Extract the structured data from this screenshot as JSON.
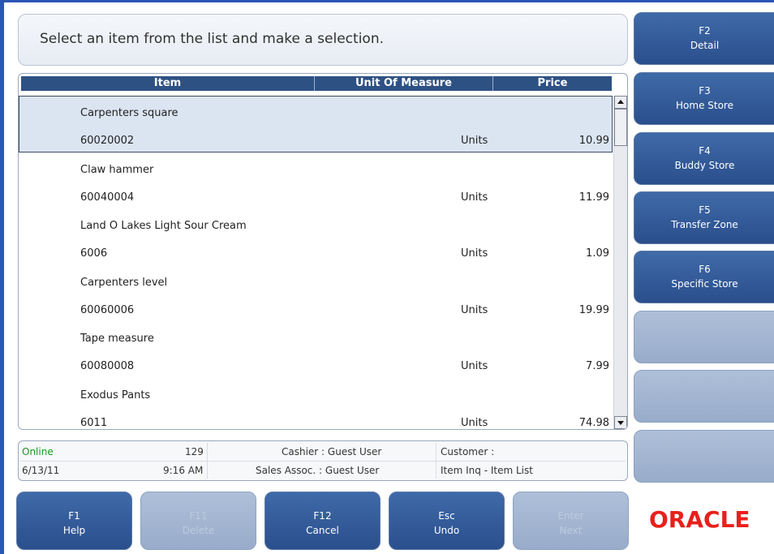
{
  "prompt": "Select an item from the list and make a selection.",
  "list": {
    "headers": {
      "item": "Item",
      "uom": "Unit Of Measure",
      "price": "Price"
    },
    "rows": [
      {
        "name": "Carpenters square",
        "code": "60020002",
        "uom": "Units",
        "price": "10.99",
        "selected": true
      },
      {
        "name": "Claw hammer",
        "code": "60040004",
        "uom": "Units",
        "price": "11.99"
      },
      {
        "name": "Land O Lakes Light Sour Cream",
        "code": "6006",
        "uom": "Units",
        "price": "1.09"
      },
      {
        "name": "Carpenters level",
        "code": "60060006",
        "uom": "Units",
        "price": "19.99"
      },
      {
        "name": "Tape measure",
        "code": "60080008",
        "uom": "Units",
        "price": "7.99"
      },
      {
        "name": "Exodus Pants",
        "code": "6011",
        "uom": "Units",
        "price": "74.98"
      }
    ]
  },
  "status": {
    "online": "Online",
    "register": "129",
    "cashier": "Cashier : Guest User",
    "customer": "Customer :",
    "date": "6/13/11",
    "time": "9:16 AM",
    "sales_assoc": "Sales Assoc. : Guest User",
    "screen": "Item Inq - Item List",
    "online_color": "#1a9a1a"
  },
  "right_buttons": [
    {
      "key": "F2",
      "label": "Detail"
    },
    {
      "key": "F3",
      "label": "Home Store"
    },
    {
      "key": "F4",
      "label": "Buddy Store"
    },
    {
      "key": "F5",
      "label": "Transfer Zone"
    },
    {
      "key": "F6",
      "label": "Specific Store"
    },
    {
      "key": "",
      "label": ""
    },
    {
      "key": "",
      "label": ""
    },
    {
      "key": "",
      "label": ""
    }
  ],
  "bottom_buttons": [
    {
      "key": "F1",
      "label": "Help",
      "enabled": true
    },
    {
      "key": "F11",
      "label": "Delete",
      "enabled": false
    },
    {
      "key": "F12",
      "label": "Cancel",
      "enabled": true
    },
    {
      "key": "Esc",
      "label": "Undo",
      "enabled": true
    },
    {
      "key": "Enter",
      "label": "Next",
      "enabled": false
    }
  ],
  "logo": "ORACLE"
}
